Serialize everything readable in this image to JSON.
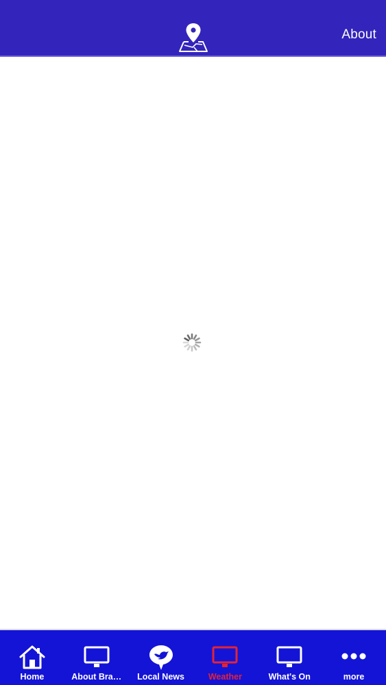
{
  "header": {
    "logo_icon": "map-pin-icon",
    "about_label": "About"
  },
  "content": {
    "loading_icon": "spinner-icon"
  },
  "tabbar": {
    "active_color": "#e32336",
    "bar_color": "#1414d6",
    "tabs": [
      {
        "label": "Home",
        "icon": "home-icon",
        "active": false
      },
      {
        "label": "About Bra…",
        "icon": "monitor-icon",
        "active": false
      },
      {
        "label": "Local News",
        "icon": "bird-bubble-icon",
        "active": false
      },
      {
        "label": "Weather",
        "icon": "monitor-icon",
        "active": true
      },
      {
        "label": "What's On",
        "icon": "monitor-icon",
        "active": false
      },
      {
        "label": "more",
        "icon": "more-dots-icon",
        "active": false
      }
    ]
  }
}
